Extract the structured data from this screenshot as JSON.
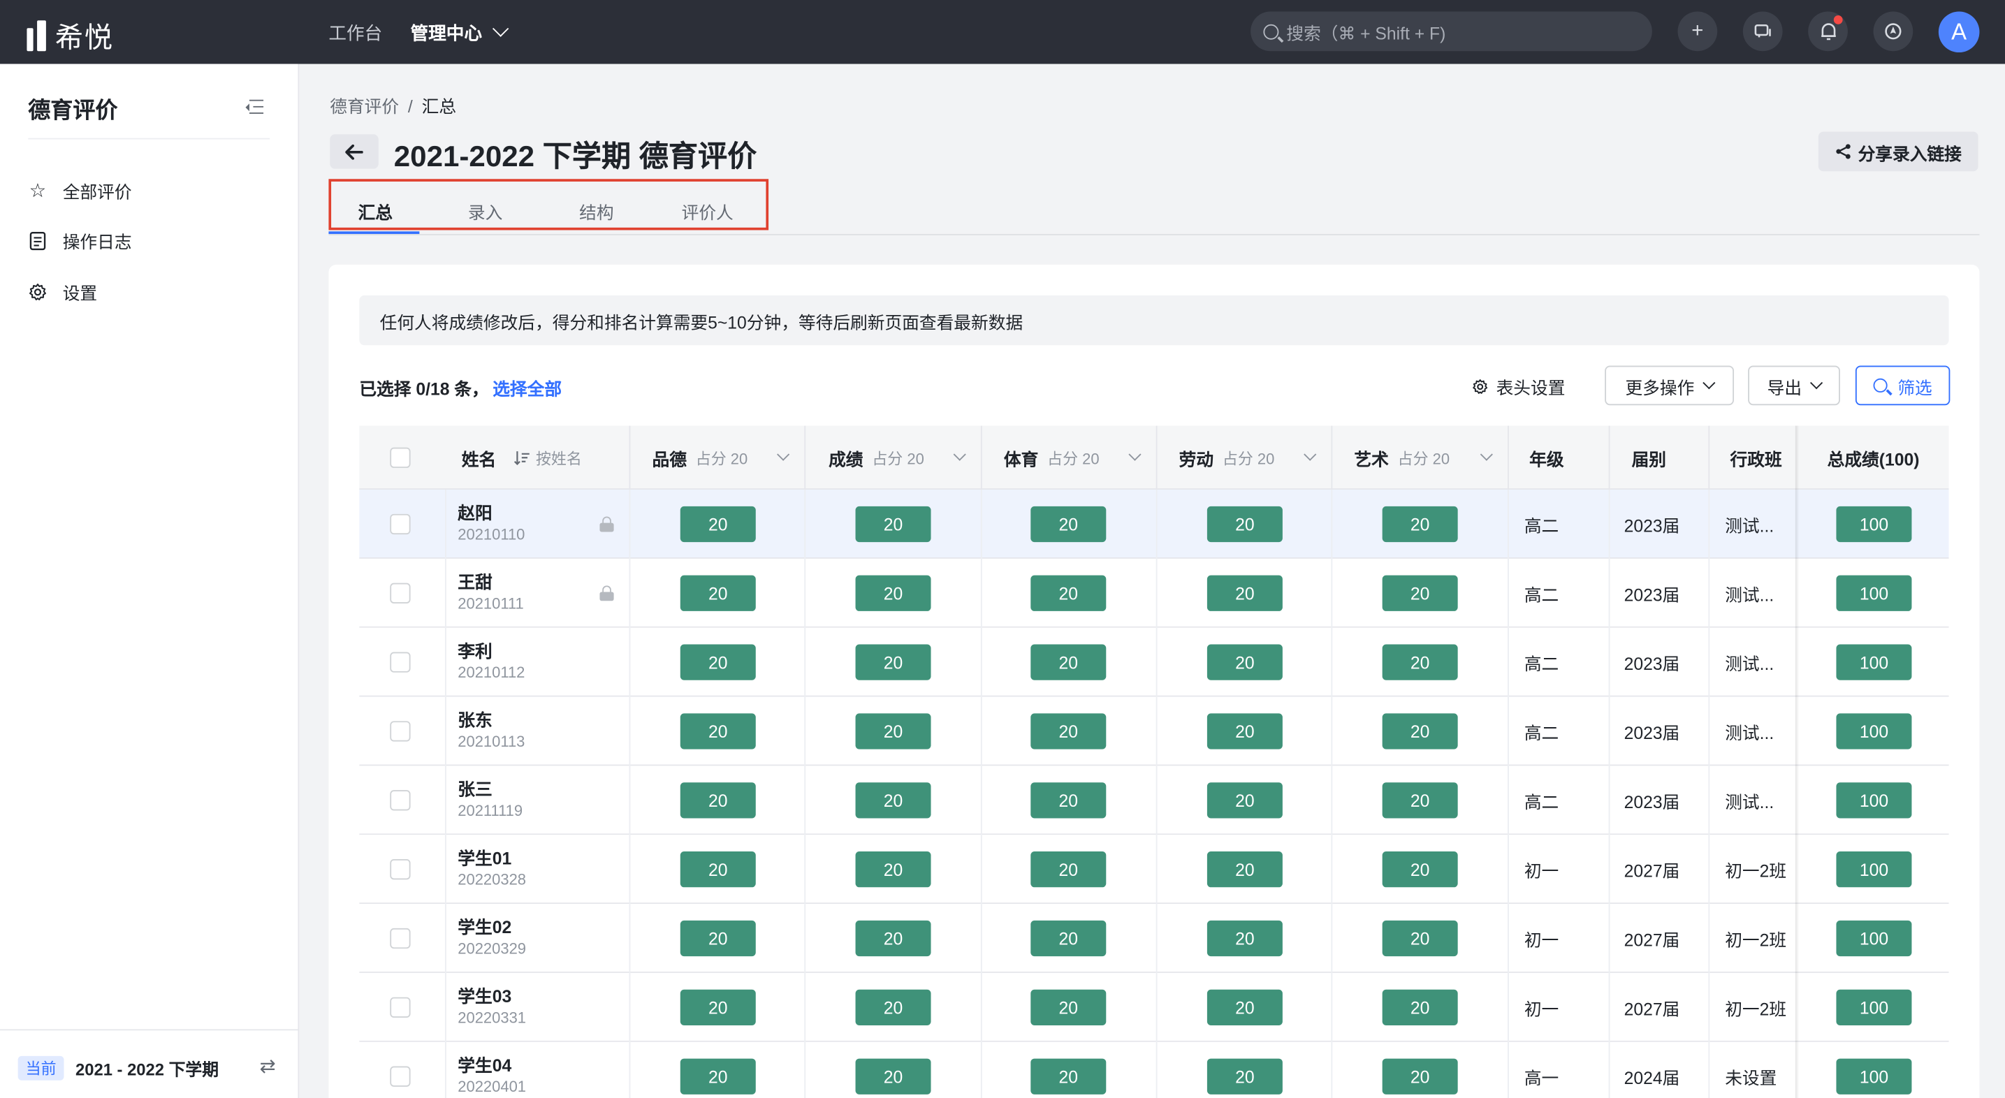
{
  "topbar": {
    "logo_text": "希悦",
    "nav": [
      "工作台",
      "管理中心"
    ],
    "search_placeholder": "搜索（⌘ + Shift + F)",
    "avatar_letter": "A"
  },
  "sidebar": {
    "title": "德育评价",
    "items": [
      {
        "label": "全部评价",
        "icon": "star-icon"
      },
      {
        "label": "操作日志",
        "icon": "log-icon"
      },
      {
        "label": "设置",
        "icon": "gear-icon"
      }
    ],
    "footer": {
      "badge": "当前",
      "term": "2021 - 2022 下学期"
    }
  },
  "breadcrumb": [
    "德育评价",
    "汇总"
  ],
  "page_title": "2021-2022 下学期 德育评价",
  "share_label": "分享录入链接",
  "tabs": [
    "汇总",
    "录入",
    "结构",
    "评价人"
  ],
  "notice": "任何人将成绩修改后，得分和排名计算需要5~10分钟，等待后刷新页面查看最新数据",
  "selection": {
    "text": "已选择 0/18 条，",
    "select_all": "选择全部"
  },
  "toolbar": {
    "header_settings": "表头设置",
    "more_actions": "更多操作",
    "export": "导出",
    "filter": "筛选"
  },
  "table": {
    "columns": {
      "name": "姓名",
      "sort": "按姓名",
      "subjects": [
        {
          "label": "品德",
          "weight": "占分 20"
        },
        {
          "label": "成绩",
          "weight": "占分 20"
        },
        {
          "label": "体育",
          "weight": "占分 20"
        },
        {
          "label": "劳动",
          "weight": "占分 20"
        },
        {
          "label": "艺术",
          "weight": "占分 20"
        }
      ],
      "grade": "年级",
      "cohort": "届别",
      "class": "行政班",
      "total": "总成绩(100)"
    },
    "rows": [
      {
        "name": "赵阳",
        "id": "20210110",
        "locked": true,
        "scores": [
          "20",
          "20",
          "20",
          "20",
          "20"
        ],
        "grade": "高二",
        "cohort": "2023届",
        "class": "测试...",
        "total": "100"
      },
      {
        "name": "王甜",
        "id": "20210111",
        "locked": true,
        "scores": [
          "20",
          "20",
          "20",
          "20",
          "20"
        ],
        "grade": "高二",
        "cohort": "2023届",
        "class": "测试...",
        "total": "100"
      },
      {
        "name": "李利",
        "id": "20210112",
        "locked": false,
        "scores": [
          "20",
          "20",
          "20",
          "20",
          "20"
        ],
        "grade": "高二",
        "cohort": "2023届",
        "class": "测试...",
        "total": "100"
      },
      {
        "name": "张东",
        "id": "20210113",
        "locked": false,
        "scores": [
          "20",
          "20",
          "20",
          "20",
          "20"
        ],
        "grade": "高二",
        "cohort": "2023届",
        "class": "测试...",
        "total": "100"
      },
      {
        "name": "张三",
        "id": "20211119",
        "locked": false,
        "scores": [
          "20",
          "20",
          "20",
          "20",
          "20"
        ],
        "grade": "高二",
        "cohort": "2023届",
        "class": "测试...",
        "total": "100"
      },
      {
        "name": "学生01",
        "id": "20220328",
        "locked": false,
        "scores": [
          "20",
          "20",
          "20",
          "20",
          "20"
        ],
        "grade": "初一",
        "cohort": "2027届",
        "class": "初一2班",
        "total": "100"
      },
      {
        "name": "学生02",
        "id": "20220329",
        "locked": false,
        "scores": [
          "20",
          "20",
          "20",
          "20",
          "20"
        ],
        "grade": "初一",
        "cohort": "2027届",
        "class": "初一2班",
        "total": "100"
      },
      {
        "name": "学生03",
        "id": "20220331",
        "locked": false,
        "scores": [
          "20",
          "20",
          "20",
          "20",
          "20"
        ],
        "grade": "初一",
        "cohort": "2027届",
        "class": "初一2班",
        "total": "100"
      },
      {
        "name": "学生04",
        "id": "20220401",
        "locked": false,
        "scores": [
          "20",
          "20",
          "20",
          "20",
          "20"
        ],
        "grade": "高一",
        "cohort": "2024届",
        "class": "未设置",
        "total": "100"
      }
    ]
  },
  "colors": {
    "accent": "#3370ff",
    "score_bg": "#3f9279",
    "topbar_bg": "#2c2f38",
    "highlight_border": "#e0412f"
  }
}
